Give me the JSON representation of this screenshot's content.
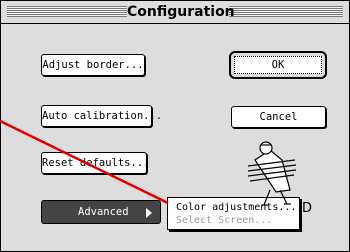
{
  "window": {
    "title": "Configuration"
  },
  "buttons": {
    "adjust_border": "Adjust border...",
    "ok": "OK",
    "auto_calibration": "Auto calibration...",
    "cancel": "Cancel",
    "reset_defaults": "Reset defaults...",
    "advanced": "Advanced"
  },
  "submenu": {
    "items": [
      {
        "label": "Color adjustments...",
        "enabled": true
      },
      {
        "label": "Select Screen...",
        "enabled": false
      }
    ]
  },
  "clipped_text": "D",
  "annotation": {
    "color": "#e00000"
  },
  "icons": [
    "scanner-figure-icon",
    "submenu-arrow-icon"
  ]
}
